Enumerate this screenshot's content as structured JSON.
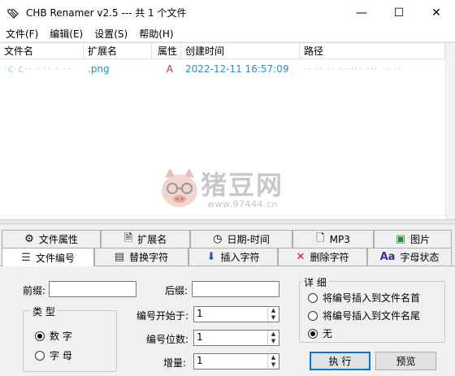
{
  "window": {
    "title": "CHB Renamer v2.5 --- 共 1 个文件",
    "minimize": "—",
    "maximize": "☐",
    "close": "✕"
  },
  "menu": [
    "文件(F)",
    "编辑(E)",
    "设置(S)",
    "帮助(H)"
  ],
  "list": {
    "columns": [
      "文件名",
      "扩展名",
      "属性",
      "创建时间",
      "路径"
    ],
    "rows": [
      {
        "name": "·c·c··  · ·· · ··",
        "ext": ".png",
        "attr": "A",
        "created": "2022-12-11 16:57:09",
        "path": "·· ·· ·· ······ ··· ·· ··"
      }
    ]
  },
  "watermark": {
    "title": "猪豆网",
    "url": "www.97444.cn"
  },
  "tabs_row1": [
    {
      "label": "文件属性",
      "icon": "gear-icon"
    },
    {
      "label": "扩展名",
      "icon": "document-icon"
    },
    {
      "label": "日期-时间",
      "icon": "clock-icon"
    },
    {
      "label": "MP3",
      "icon": "music-file-icon"
    },
    {
      "label": "图片",
      "icon": "image-icon"
    }
  ],
  "tabs_row2": [
    {
      "label": "文件编号",
      "icon": "list-icon",
      "active": true
    },
    {
      "label": "替换字符",
      "icon": "replace-icon"
    },
    {
      "label": "插入字符",
      "icon": "insert-icon"
    },
    {
      "label": "删除字符",
      "icon": "delete-icon"
    },
    {
      "label": "字母状态",
      "icon": "text-case-icon"
    }
  ],
  "panel": {
    "prefix_label": "前缀:",
    "prefix_value": "",
    "suffix_label": "后缀:",
    "suffix_value": "",
    "type_group": "类 型",
    "type_options": [
      {
        "label": "数 字",
        "checked": true
      },
      {
        "label": "字 母",
        "checked": false
      }
    ],
    "start_label": "编号开始于:",
    "start_value": "1",
    "digits_label": "编号位数:",
    "digits_value": "1",
    "increment_label": "增量:",
    "increment_value": "1",
    "detail_group": "详 细",
    "detail_options": [
      {
        "label": "将编号插入到文件名首",
        "checked": false
      },
      {
        "label": "将编号插入到文件名尾",
        "checked": false
      },
      {
        "label": "无",
        "checked": true
      }
    ],
    "execute_button": "执 行",
    "preview_button": "预览"
  },
  "colors": {
    "accent": "#2c8fb8",
    "attr_red": "#d0204a"
  }
}
